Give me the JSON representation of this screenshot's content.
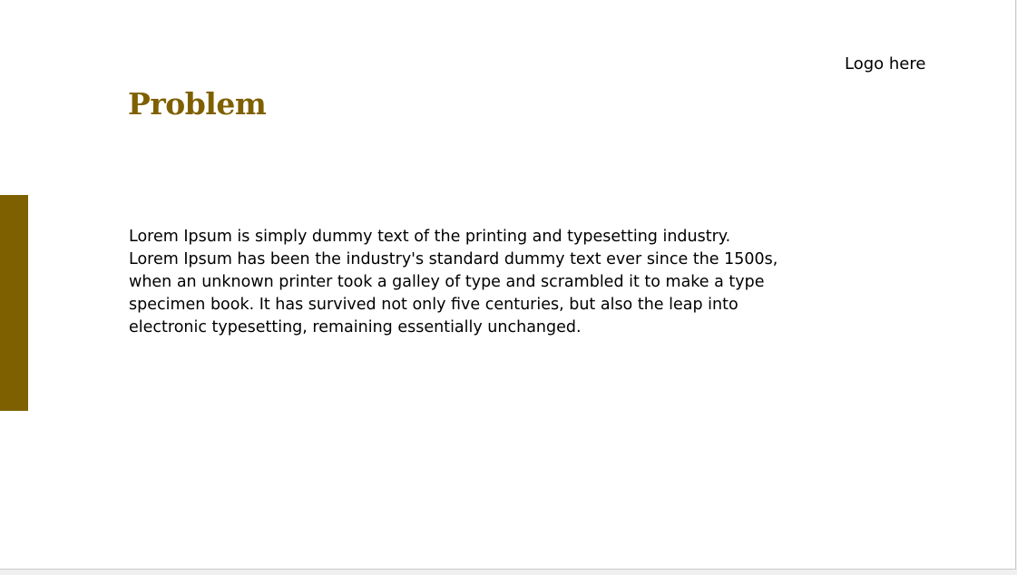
{
  "colors": {
    "accent": "#7f6000",
    "text": "#000000",
    "background": "#ffffff"
  },
  "slide": {
    "title": "Problem",
    "logo_text": "Logo here",
    "body_lines": [
      "Lorem Ipsum is simply dummy text of the printing and typesetting industry.",
      "Lorem Ipsum has been the industry's standard dummy text ever since the 1500s,",
      "when an unknown printer took a galley of type and scrambled it to make a type",
      "specimen book. It has survived not only five centuries, but also the leap into",
      "electronic typesetting, remaining essentially unchanged."
    ]
  }
}
